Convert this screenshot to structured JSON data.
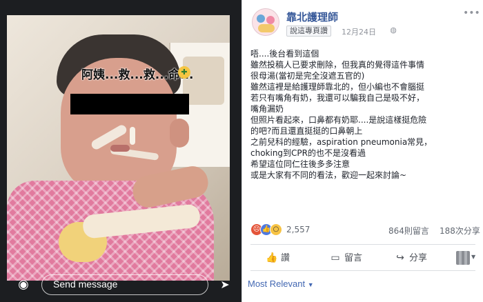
{
  "story": {
    "caption": "阿姨...救...救...命...",
    "caption_emoji": "🤢",
    "send_placeholder": "Send message",
    "camera_icon": "camera-icon",
    "send_icon": "send-icon"
  },
  "post": {
    "page_name": "靠北護理師",
    "like_page_label": "說這專頁讚",
    "date": "12月24日",
    "privacy_icon": "globe-icon",
    "body_lines": [
      "唔....後台看到這個",
      "雖然投稿人已要求刪除，但我真的覺得這件事情",
      "很母湯(當初是完全沒遮五官的)",
      "雖然這裡是給護理師靠北的，但小編也不會腦挺",
      "若只有嘴角有奶，我還可以騙我自己是吸不好，",
      "嘴角漏奶",
      "但照片看起來，口鼻都有奶耶....是說這樣挺危險",
      "的吧?而且還直挺挺的口鼻朝上",
      "之前兒科的經驗，aspiration pneumonia常見，",
      "choking到CPR的也不是沒看過",
      "希望這位同仁往後多多注意",
      "或是大家有不同的看法，歡迎一起來討論~"
    ],
    "reactions": {
      "count": "2,557",
      "icons": [
        "angry-reaction",
        "like-reaction",
        "wow-reaction"
      ]
    },
    "comment_count": "864則留言",
    "share_count": "188次分享",
    "actions": {
      "like": "讚",
      "comment": "留言",
      "share": "分享"
    },
    "sort_label": "Most Relevant"
  },
  "colors": {
    "link_blue": "#365899",
    "facebook_blue": "#4267b2",
    "story_background": "#1c1e21"
  }
}
